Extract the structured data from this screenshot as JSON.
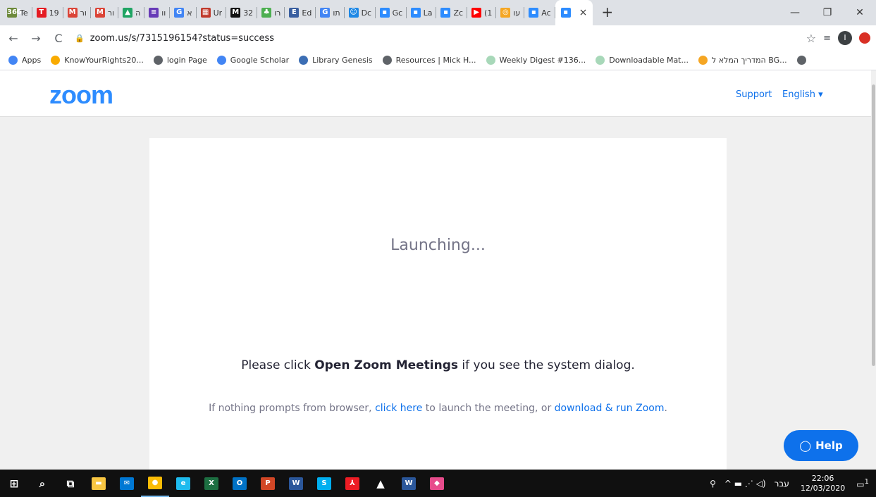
{
  "browser": {
    "tabs": [
      {
        "label": "Te",
        "color": "#6d8a3b",
        "glyph": "360"
      },
      {
        "label": "19",
        "color": "#e51c23",
        "glyph": "T"
      },
      {
        "label": "ור",
        "color": "#db4437",
        "glyph": "M"
      },
      {
        "label": "ור",
        "color": "#db4437",
        "glyph": "M"
      },
      {
        "label": "ה",
        "color": "#1fa463",
        "glyph": "▲"
      },
      {
        "label": "וו",
        "color": "#673ab7",
        "glyph": "≡"
      },
      {
        "label": "א",
        "color": "#4285f4",
        "glyph": "G"
      },
      {
        "label": "Ur",
        "color": "#c0392b",
        "glyph": "▦"
      },
      {
        "label": "32",
        "color": "#111111",
        "glyph": "M"
      },
      {
        "label": "רו",
        "color": "#4caf50",
        "glyph": "♣"
      },
      {
        "label": "Ed",
        "color": "#3a5fa0",
        "glyph": "E"
      },
      {
        "label": "תו",
        "color": "#4285f4",
        "glyph": "G"
      },
      {
        "label": "Dc",
        "color": "#1e88e5",
        "glyph": "☺"
      },
      {
        "label": "Gc",
        "color": "#2d8cff",
        "glyph": "▪"
      },
      {
        "label": "La",
        "color": "#2d8cff",
        "glyph": "▪"
      },
      {
        "label": "Zc",
        "color": "#2d8cff",
        "glyph": "▪"
      },
      {
        "label": "(1",
        "color": "#ff0000",
        "glyph": "▶"
      },
      {
        "label": "עו",
        "color": "#f5a623",
        "glyph": "◎"
      },
      {
        "label": "Ac",
        "color": "#2d8cff",
        "glyph": "▪"
      }
    ],
    "active_tab_close": "×",
    "new_tab": "+",
    "window_controls": {
      "minimize": "—",
      "restore": "❐",
      "close": "✕"
    },
    "url": "zoom.us/s/7315196154?status=success",
    "bookmarks": [
      {
        "label": "Apps",
        "color": "#4285f4"
      },
      {
        "label": "KnowYourRights20...",
        "color": "#f9ab00"
      },
      {
        "label": "login Page",
        "color": "#5f6368"
      },
      {
        "label": "Google Scholar",
        "color": "#4285f4"
      },
      {
        "label": "Library Genesis",
        "color": "#3c6eb4"
      },
      {
        "label": "Resources | Mick H...",
        "color": "#5f6368"
      },
      {
        "label": "Weekly Digest #136...",
        "color": "#a8d8b9"
      },
      {
        "label": "Downloadable Mat...",
        "color": "#a8d8b9"
      },
      {
        "label": "המדריך המלא ל BG...",
        "color": "#f5a623"
      },
      {
        "label": "",
        "color": "#5f6368"
      }
    ]
  },
  "page": {
    "logo": "zoom",
    "support": "Support",
    "language": "English ▾",
    "launching": "Launching...",
    "please_prefix": "Please click ",
    "please_bold": "Open Zoom Meetings",
    "please_suffix": " if you see the system dialog.",
    "nothing_prefix": "If nothing prompts from browser, ",
    "click_here": "click here",
    "nothing_middle": " to launch the meeting, or ",
    "download_link": "download & run Zoom",
    "nothing_suffix": ".",
    "help_button": "Help"
  },
  "taskbar": {
    "apps": [
      {
        "name": "start",
        "glyph": "⊞",
        "color": "#ffffff"
      },
      {
        "name": "search",
        "glyph": "⌕",
        "color": "#ffffff"
      },
      {
        "name": "task-view",
        "glyph": "⧉",
        "color": "#ffffff"
      },
      {
        "name": "file-explorer",
        "glyph": "▬",
        "color": "#f8c642"
      },
      {
        "name": "mail",
        "glyph": "✉",
        "color": "#0078d4"
      },
      {
        "name": "chrome",
        "glyph": "●",
        "color": "#fbbc05"
      },
      {
        "name": "internet-explorer",
        "glyph": "e",
        "color": "#1ebbee"
      },
      {
        "name": "excel",
        "glyph": "X",
        "color": "#1d6f42"
      },
      {
        "name": "outlook",
        "glyph": "O",
        "color": "#0072c6"
      },
      {
        "name": "powerpoint",
        "glyph": "P",
        "color": "#d24726"
      },
      {
        "name": "word",
        "glyph": "W",
        "color": "#2b579a"
      },
      {
        "name": "skype",
        "glyph": "S",
        "color": "#00aff0"
      },
      {
        "name": "acrobat",
        "glyph": "⅄",
        "color": "#ed1c24"
      },
      {
        "name": "photos",
        "glyph": "▲",
        "color": "#ffffff"
      },
      {
        "name": "word-2",
        "glyph": "W",
        "color": "#2b579a"
      },
      {
        "name": "paint-3d",
        "glyph": "◆",
        "color": "#e74c8c"
      }
    ],
    "tray_people": "⚲",
    "tray_icons": "^  ▬  ⋰  ◁)",
    "language": "עבר",
    "time": "22:06",
    "date": "12/03/2020",
    "notifications": "1"
  }
}
